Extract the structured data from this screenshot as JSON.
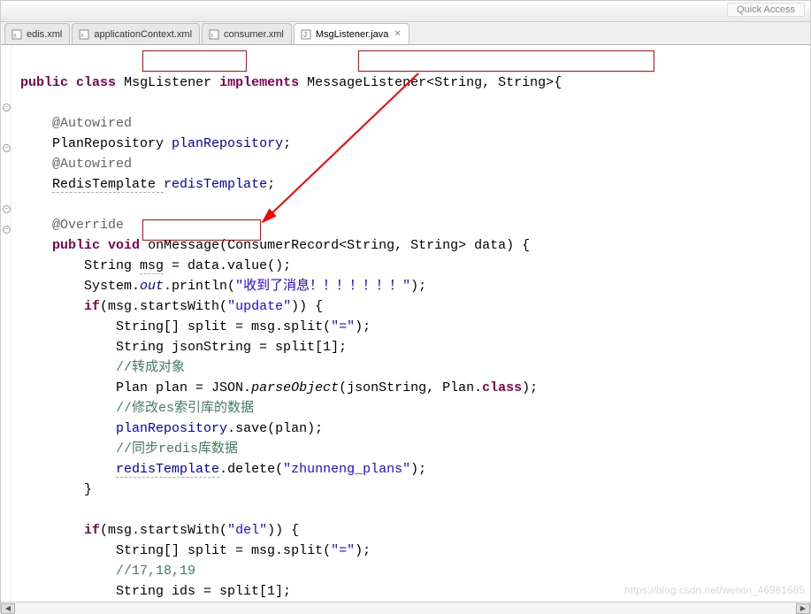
{
  "topbar": {
    "quick_access": "Quick Access"
  },
  "tabs": [
    {
      "label": "edis.xml",
      "icon": "xml-file-icon",
      "active": false,
      "closable": false
    },
    {
      "label": "applicationContext.xml",
      "icon": "xml-file-icon",
      "active": false,
      "closable": false
    },
    {
      "label": "consumer.xml",
      "icon": "xml-file-icon",
      "active": false,
      "closable": false
    },
    {
      "label": "MsgListener.java",
      "icon": "java-file-icon",
      "active": true,
      "closable": true
    }
  ],
  "code": {
    "l1_public": "public",
    "l1_class": "class",
    "l1_clsname": "MsgListener",
    "l1_impl": "implements",
    "l1_iface": "MessageListener<String, String>",
    "l1_br": "{",
    "l3_ann": "@Autowired",
    "l4a": "PlanRepository ",
    "l4b": "planRepository",
    "l4c": ";",
    "l5_ann": "@Autowired",
    "l6a": "RedisTemplate ",
    "l6b": "redisTemplate",
    "l6c": ";",
    "l8_ann": "@Override",
    "l9_public": "public",
    "l9_void": "void",
    "l9_meth": " onMessage",
    "l9_sig": "(ConsumerRecord<String, String> data) {",
    "l10a": "String ",
    "l10b": "msg",
    "l10c": " = data.value();",
    "l11a": "System.",
    "l11b": "out",
    "l11c": ".println(",
    "l11d": "\"收到了消息！！！！！！！\"",
    "l11e": ");",
    "l12a": "if",
    "l12b": "(msg.startsWith(",
    "l12c": "\"update\"",
    "l12d": ")) {",
    "l13a": "String[] split = msg.split(",
    "l13b": "\"=\"",
    "l13c": ");",
    "l14a": "String jsonString = split[1];",
    "l15": "//转成对象",
    "l16a": "Plan plan = JSON.",
    "l16b": "parseObject",
    "l16c": "(jsonString, Plan.",
    "l16d": "class",
    "l16e": ");",
    "l17": "//修改es索引库的数据",
    "l18a": "planRepository",
    "l18b": ".save(plan);",
    "l19": "//同步redis库数据",
    "l20a": "redisTemplate",
    "l20b": ".delete(",
    "l20c": "\"zhunneng_plans\"",
    "l20d": ");",
    "l21": "}",
    "l23a": "if",
    "l23b": "(msg.startsWith(",
    "l23c": "\"del\"",
    "l23d": ")) {",
    "l24a": "String[] split = msg.split(",
    "l24b": "\"=\"",
    "l24c": ");",
    "l25": "//17,18,19",
    "l26": "String ids = split[1];"
  },
  "watermark": "https://blog.csdn.net/weixin_46981685",
  "annotations": {
    "box1": "MsgListener highlight",
    "box2": "MessageListener<String,String> highlight",
    "box3": "onMessage highlight",
    "arrow": "arrow from interface to onMessage"
  }
}
